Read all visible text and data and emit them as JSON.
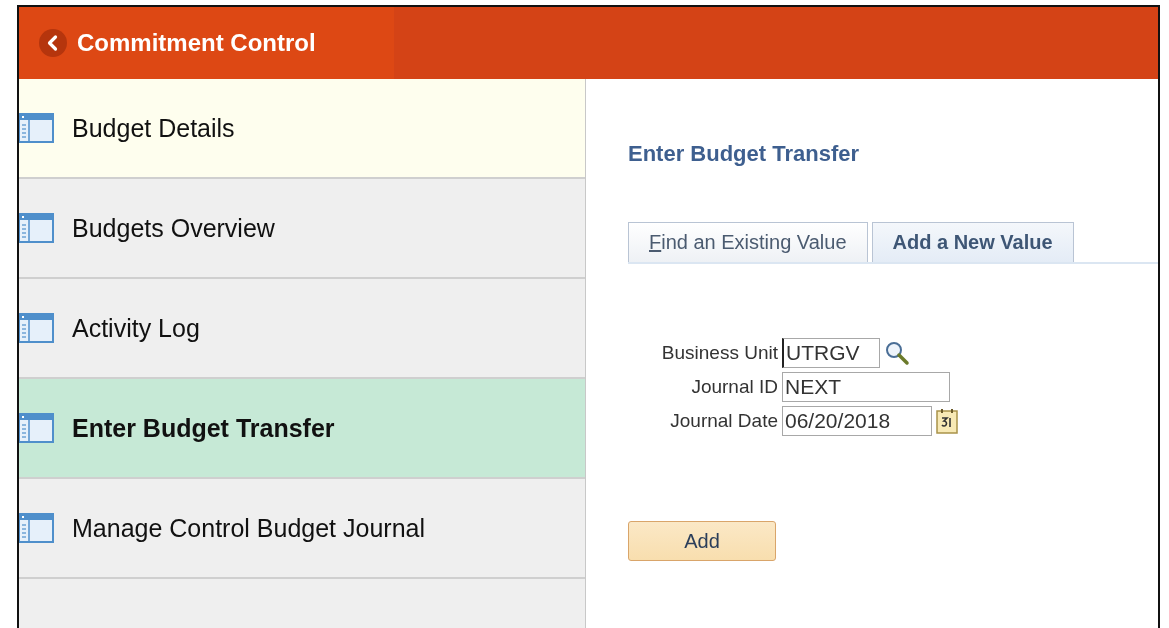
{
  "header": {
    "title": "Commitment Control"
  },
  "sidebar": {
    "items": [
      {
        "label": "Budget Details",
        "selected": false,
        "hovered": true
      },
      {
        "label": "Budgets Overview",
        "selected": false,
        "hovered": false
      },
      {
        "label": "Activity Log",
        "selected": false,
        "hovered": false
      },
      {
        "label": "Enter Budget Transfer",
        "selected": true,
        "hovered": false
      },
      {
        "label": "Manage Control Budget Journal",
        "selected": false,
        "hovered": false
      }
    ]
  },
  "page": {
    "title": "Enter Budget Transfer",
    "tabs": [
      {
        "label": "Find an Existing Value",
        "selected": false
      },
      {
        "label": "Add a New Value",
        "selected": true
      }
    ],
    "fields": [
      {
        "label": "Business Unit",
        "value": "UTRGV",
        "kind": "lookup",
        "focused": true
      },
      {
        "label": "Journal ID",
        "value": "NEXT",
        "kind": "text",
        "focused": false
      },
      {
        "label": "Journal Date",
        "value": "06/20/2018",
        "kind": "date",
        "focused": false
      }
    ],
    "button": "Add"
  }
}
